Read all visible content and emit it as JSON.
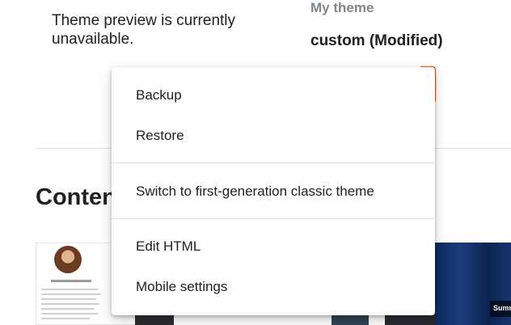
{
  "preview": {
    "message": "Theme preview is currently unavailable."
  },
  "my_theme": {
    "label": "My theme",
    "name": "custom (Modified)"
  },
  "content_section": {
    "heading": "Content"
  },
  "thumbnails": {
    "second_caption": "Summ"
  },
  "menu": {
    "items": [
      {
        "label": "Backup"
      },
      {
        "label": "Restore"
      },
      {
        "label": "Switch to first-generation classic theme"
      },
      {
        "label": "Edit HTML"
      },
      {
        "label": "Mobile settings"
      }
    ]
  },
  "colors": {
    "accent": "#d9531e",
    "divider": "#dadce0"
  }
}
